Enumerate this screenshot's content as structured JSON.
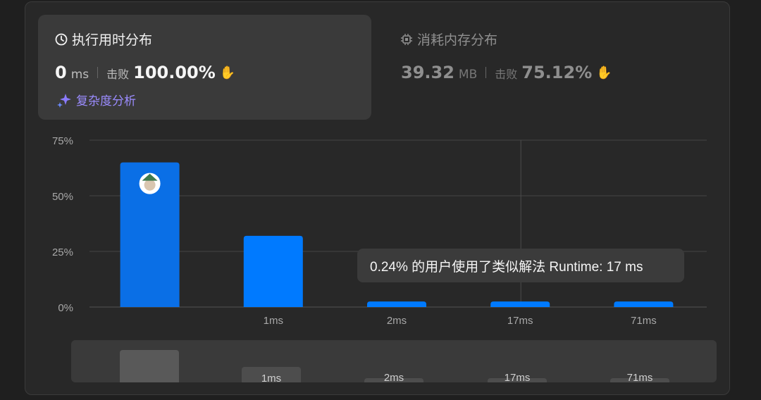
{
  "runtime": {
    "title": "执行用时分布",
    "value": "0",
    "unit": "ms",
    "beat_label": "击败",
    "beat_value": "100.00%",
    "complexity_link": "复杂度分析"
  },
  "memory": {
    "title": "消耗内存分布",
    "value": "39.32",
    "unit": "MB",
    "beat_label": "击败",
    "beat_value": "75.12%"
  },
  "tooltip": {
    "text": "0.24% 的用户使用了类似解法 Runtime: 17 ms"
  },
  "chart_data": {
    "type": "bar",
    "categories": [
      "",
      "1ms",
      "2ms",
      "17ms",
      "71ms"
    ],
    "values": [
      65,
      32,
      2.5,
      2.5,
      2.5
    ],
    "y_ticks": [
      "75%",
      "50%",
      "25%",
      "0%"
    ],
    "ylim": [
      0,
      75
    ],
    "highlight_index": 0,
    "colors": {
      "bar": "#007aff",
      "bar_active": "#0a6fe6",
      "grid": "#444444"
    }
  },
  "navigator": {
    "labels": [
      "",
      "1ms",
      "2ms",
      "17ms",
      "71ms"
    ]
  },
  "icons": {
    "runtime": "clock-icon",
    "memory": "chip-icon",
    "beat": "clap-icon",
    "complexity": "sparkle-icon",
    "avatar": "avatar"
  }
}
